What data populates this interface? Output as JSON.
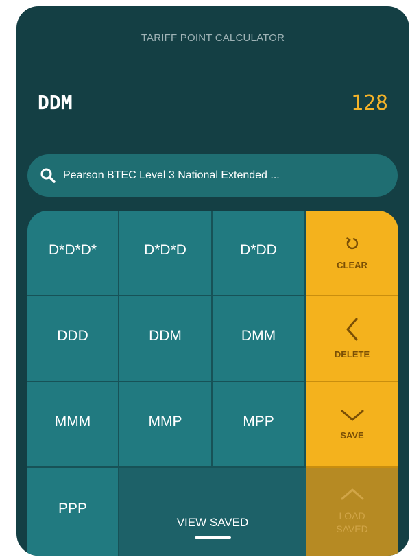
{
  "header": {
    "title": "TARIFF POINT CALCULATOR",
    "grades": "DDM",
    "points": "128"
  },
  "search": {
    "icon": "search-icon",
    "text": "Pearson BTEC Level 3 National Extended ..."
  },
  "keypad": {
    "grades": [
      "D*D*D*",
      "D*D*D",
      "D*DD",
      "DDD",
      "DDM",
      "DMM",
      "MMM",
      "MMP",
      "MPP",
      "PPP"
    ],
    "actions": {
      "clear": "CLEAR",
      "delete": "DELETE",
      "save": "SAVE",
      "load_saved": "LOAD SAVED"
    },
    "view_saved": "VIEW SAVED"
  },
  "colors": {
    "background": "#143F44",
    "accent": "#F4B21D",
    "key": "#217A80",
    "points": "#F3B229"
  }
}
